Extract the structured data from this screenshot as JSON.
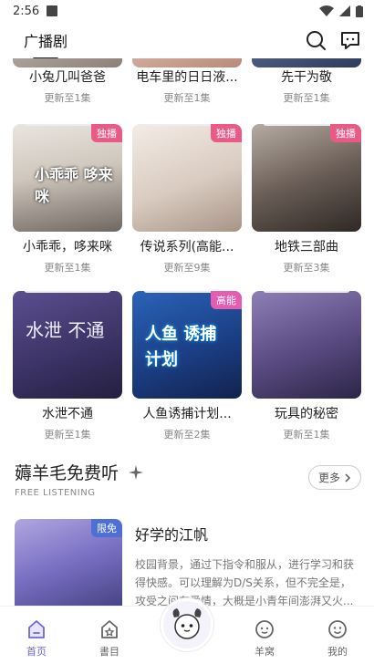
{
  "status": {
    "time": "2:56"
  },
  "header": {
    "title": "广播剧"
  },
  "rows": [
    {
      "items": [
        {
          "name": "小兔几叫爸爸",
          "update": "更新至1集"
        },
        {
          "name": "电车里的日日液...",
          "update": "更新至1集"
        },
        {
          "name": "先干为敬",
          "update": "更新至1集"
        }
      ]
    },
    {
      "items": [
        {
          "name": "小乖乖，哆来咪",
          "update": "更新至1集",
          "badge": "独播",
          "art": "小乖乖 哆来咪"
        },
        {
          "name": "传说系列(高能...",
          "update": "更新至9集",
          "badge": "独播"
        },
        {
          "name": "地铁三部曲",
          "update": "更新至3集",
          "badge": "独播"
        }
      ]
    },
    {
      "items": [
        {
          "name": "水泄不通",
          "update": "更新至1集",
          "art": "水泄 不通"
        },
        {
          "name": "人鱼诱捕计划...",
          "update": "更新至2集",
          "badge": "高能",
          "art": "人鱼 诱捕计划"
        },
        {
          "name": "玩具的秘密",
          "update": "更新至1集"
        }
      ]
    }
  ],
  "section": {
    "title": "薅羊毛免费听",
    "subtitle": "FREE LISTENING",
    "more": "更多"
  },
  "feature": {
    "badge": "限免",
    "title": "好学的江帆",
    "desc": "校园背景，通过下指令和服从，进行学习和获得快感。可以理解为D/S关系，但不完全是，攻受之间有爱情，大概是小青年间澎湃又火..."
  },
  "tabs": [
    {
      "label": "首页",
      "icon": "home-icon"
    },
    {
      "label": "書目",
      "icon": "catalog-icon"
    },
    {
      "label": "",
      "icon": "avatar"
    },
    {
      "label": "羊窝",
      "icon": "sheep-icon"
    },
    {
      "label": "我的",
      "icon": "profile-icon"
    }
  ],
  "colors": {
    "accent": "#6c68d6",
    "badge_exclusive": "#ea5a86",
    "badge_limited": "#4d6fd6"
  }
}
